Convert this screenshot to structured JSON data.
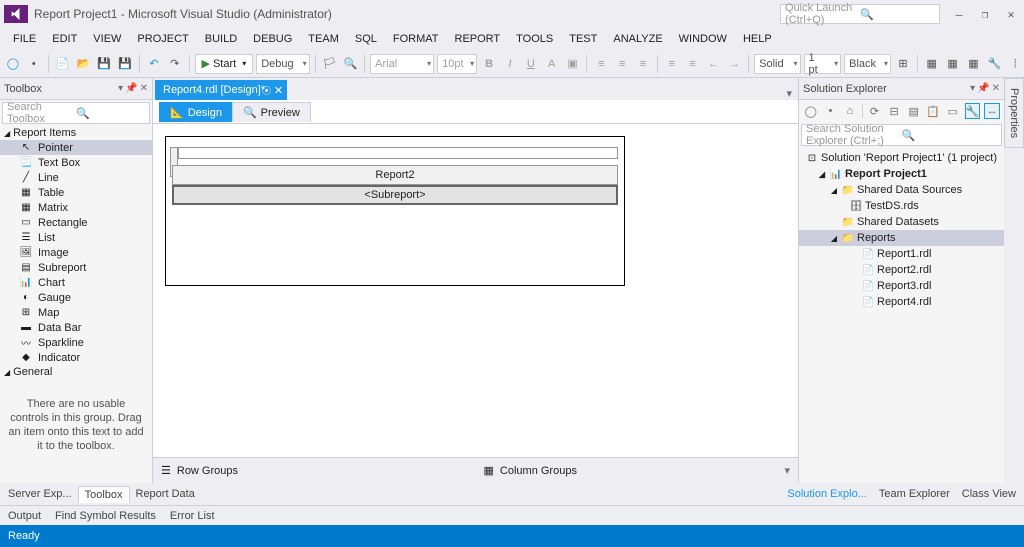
{
  "window": {
    "title": "Report Project1 - Microsoft Visual Studio (Administrator)",
    "quick_launch_placeholder": "Quick Launch (Ctrl+Q)"
  },
  "menu": [
    "FILE",
    "EDIT",
    "VIEW",
    "PROJECT",
    "BUILD",
    "DEBUG",
    "TEAM",
    "SQL",
    "FORMAT",
    "REPORT",
    "TOOLS",
    "TEST",
    "ANALYZE",
    "WINDOW",
    "HELP"
  ],
  "toolbar": {
    "start": "Start",
    "config": "Debug",
    "font": "Arial",
    "size": "10pt",
    "border_style": "Solid",
    "border_width": "1 pt",
    "border_color": "Black"
  },
  "toolbox": {
    "title": "Toolbox",
    "search_placeholder": "Search Toolbox",
    "section1": "Report Items",
    "items": [
      {
        "name": "Pointer",
        "icon": "↖"
      },
      {
        "name": "Text Box",
        "icon": "📃"
      },
      {
        "name": "Line",
        "icon": "╱"
      },
      {
        "name": "Table",
        "icon": "▦"
      },
      {
        "name": "Matrix",
        "icon": "▦"
      },
      {
        "name": "Rectangle",
        "icon": "▭"
      },
      {
        "name": "List",
        "icon": "☰"
      },
      {
        "name": "Image",
        "icon": "🖼"
      },
      {
        "name": "Subreport",
        "icon": "▤"
      },
      {
        "name": "Chart",
        "icon": "📊"
      },
      {
        "name": "Gauge",
        "icon": "◐"
      },
      {
        "name": "Map",
        "icon": "⊞"
      },
      {
        "name": "Data Bar",
        "icon": "▬"
      },
      {
        "name": "Sparkline",
        "icon": "〰"
      },
      {
        "name": "Indicator",
        "icon": "◆"
      }
    ],
    "section2": "General",
    "general_msg": "There are no usable controls in this group. Drag an item onto this text to add it to the toolbox."
  },
  "document": {
    "tab_title": "Report4.rdl [Design]*",
    "design_tab": "Design",
    "preview_tab": "Preview",
    "canvas_header": "Report2",
    "canvas_sub": "<Subreport>"
  },
  "groups": {
    "row_label": "Row Groups",
    "col_label": "Column Groups"
  },
  "solution": {
    "title": "Solution Explorer",
    "search_placeholder": "Search Solution Explorer (Ctrl+;)",
    "root": "Solution 'Report Project1' (1 project)",
    "project": "Report Project1",
    "shared_ds": "Shared Data Sources",
    "test_ds": "TestDS.rds",
    "shared_datasets": "Shared Datasets",
    "reports_folder": "Reports",
    "reports": [
      "Report1.rdl",
      "Report2.rdl",
      "Report3.rdl",
      "Report4.rdl"
    ],
    "properties_tab": "Properties"
  },
  "bottom": {
    "left_tabs": [
      "Server Exp...",
      "Toolbox",
      "Report Data"
    ],
    "right_tabs": [
      "Solution Explo...",
      "Team Explorer",
      "Class View"
    ],
    "output_tabs": [
      "Output",
      "Find Symbol Results",
      "Error List"
    ]
  },
  "status": "Ready"
}
